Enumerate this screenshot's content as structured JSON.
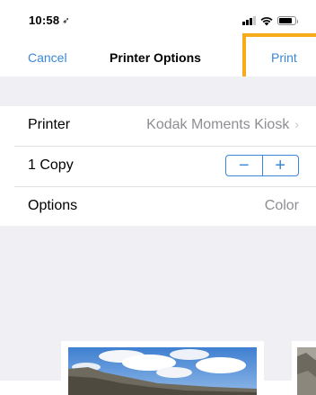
{
  "status_bar": {
    "time": "10:58",
    "location_arrow": "➶",
    "signal_bars": 3,
    "battery_level": 0.8
  },
  "nav": {
    "cancel_label": "Cancel",
    "title": "Printer Options",
    "print_label": "Print"
  },
  "rows": {
    "printer": {
      "label": "Printer",
      "value": "Kodak Moments Kiosk",
      "chevron": "›"
    },
    "copies": {
      "label": "1 Copy",
      "minus": "−",
      "plus": "+"
    },
    "options": {
      "label": "Options",
      "value": "Color"
    }
  },
  "colors": {
    "accent": "#3a87d6",
    "highlight": "#f7aa1b",
    "background_gray": "#efeff4"
  },
  "icons": [
    "location-arrow-icon",
    "signal-icon",
    "wifi-icon",
    "battery-icon",
    "chevron-right-icon"
  ]
}
